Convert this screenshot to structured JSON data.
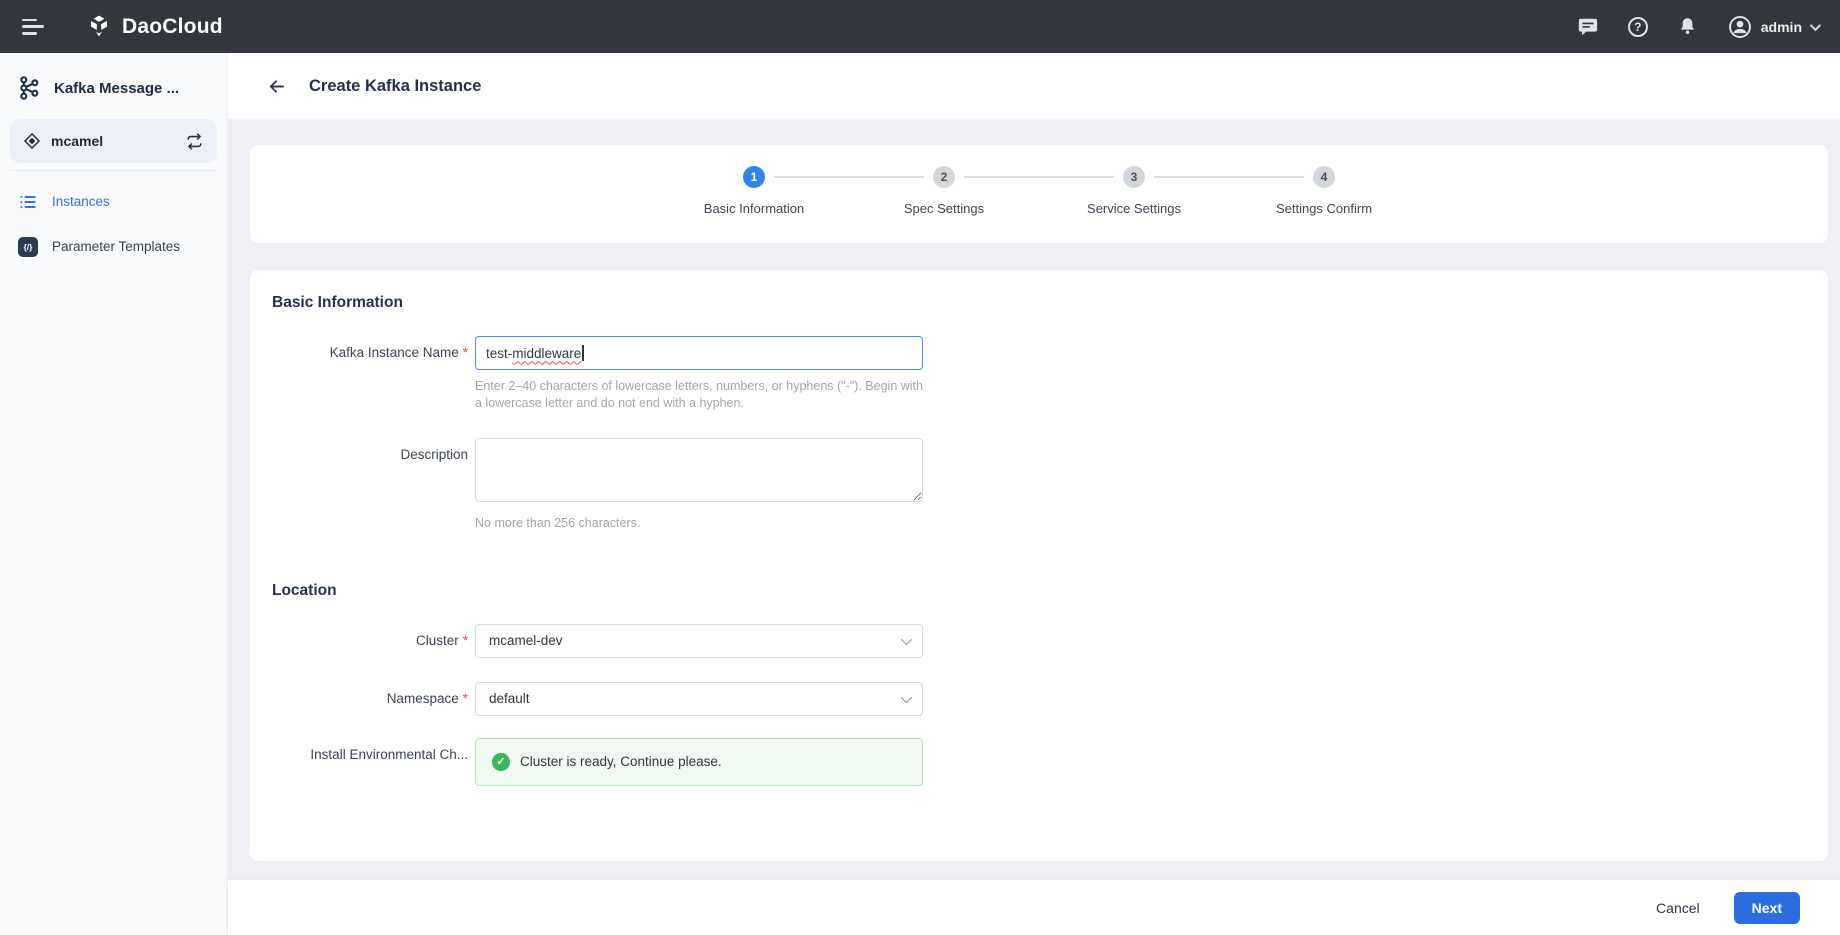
{
  "colors": {
    "navbar_bg": "#32373e",
    "accent_blue": "#2b6de0",
    "step_active_blue": "#2f86e8",
    "sidebar_active_blue": "#3a6fe0",
    "success_green": "#3bb75a",
    "required_red": "#e04f4f"
  },
  "navbar": {
    "brand": "DaoCloud",
    "username": "admin",
    "help_glyph": "?"
  },
  "sidebar": {
    "app_title": "Kafka Message ...",
    "workspace": "mcamel",
    "param_icon_glyph": "{/}",
    "items": [
      {
        "label": "Instances"
      },
      {
        "label": "Parameter Templates"
      }
    ]
  },
  "page_header": {
    "title": "Create Kafka Instance"
  },
  "stepper": {
    "steps": [
      {
        "num": "1",
        "label": "Basic Information"
      },
      {
        "num": "2",
        "label": "Spec Settings"
      },
      {
        "num": "3",
        "label": "Service Settings"
      },
      {
        "num": "4",
        "label": "Settings Confirm"
      }
    ]
  },
  "form": {
    "basic_section_title": "Basic Information",
    "required_mark": "*",
    "name": {
      "label": "Kafka Instance Name",
      "value_prefix": "test-",
      "value_flagged": "middleware",
      "hint": "Enter 2–40 characters of lowercase letters, numbers, or hyphens (\"-\"). Begin with a lowercase letter and do not end with a hyphen."
    },
    "description": {
      "label": "Description",
      "hint": "No more than 256 characters."
    },
    "location_section_title": "Location",
    "cluster": {
      "label": "Cluster",
      "value": "mcamel-dev"
    },
    "namespace": {
      "label": "Namespace",
      "value": "default"
    },
    "env_check": {
      "label": "Install Environmental Ch...",
      "message": "Cluster is ready, Continue please.",
      "check_glyph": "✓"
    }
  },
  "footer": {
    "cancel_label": "Cancel",
    "next_label": "Next"
  }
}
